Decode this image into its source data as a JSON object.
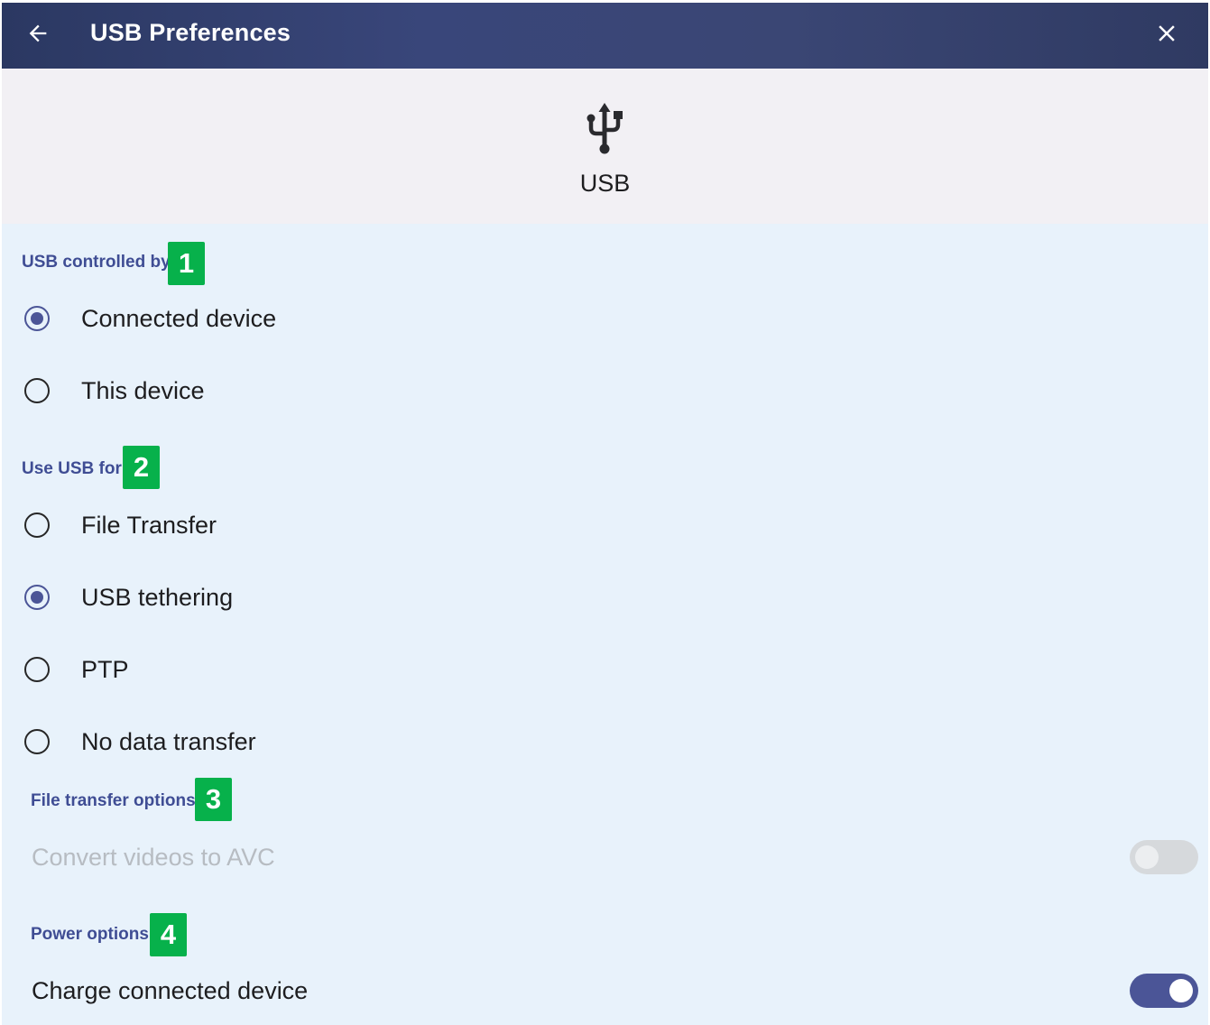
{
  "window": {
    "title": "USB Preferences",
    "back_icon": "arrow-left-icon",
    "close_icon": "close-icon"
  },
  "hero": {
    "icon": "usb-icon",
    "label": "USB"
  },
  "sections": {
    "controlled_by": {
      "header": "USB controlled by",
      "badge": "1",
      "options": [
        {
          "label": "Connected device",
          "selected": true
        },
        {
          "label": "This device",
          "selected": false
        }
      ]
    },
    "use_for": {
      "header": "Use USB for",
      "badge": "2",
      "options": [
        {
          "label": "File Transfer",
          "selected": false
        },
        {
          "label": "USB tethering",
          "selected": true
        },
        {
          "label": "PTP",
          "selected": false
        },
        {
          "label": "No data transfer",
          "selected": false
        }
      ]
    },
    "file_transfer": {
      "header": "File transfer options",
      "badge": "3",
      "convert_label": "Convert videos to AVC",
      "convert_enabled": false,
      "convert_on": false
    },
    "power": {
      "header": "Power options",
      "badge": "4",
      "charge_label": "Charge connected device",
      "charge_on": true
    }
  },
  "colors": {
    "accent": "#4b5597",
    "header_text": "#3f4d94",
    "badge": "#07b14b",
    "titlebar": "#39467a",
    "content_bg": "#e8f2fb"
  }
}
